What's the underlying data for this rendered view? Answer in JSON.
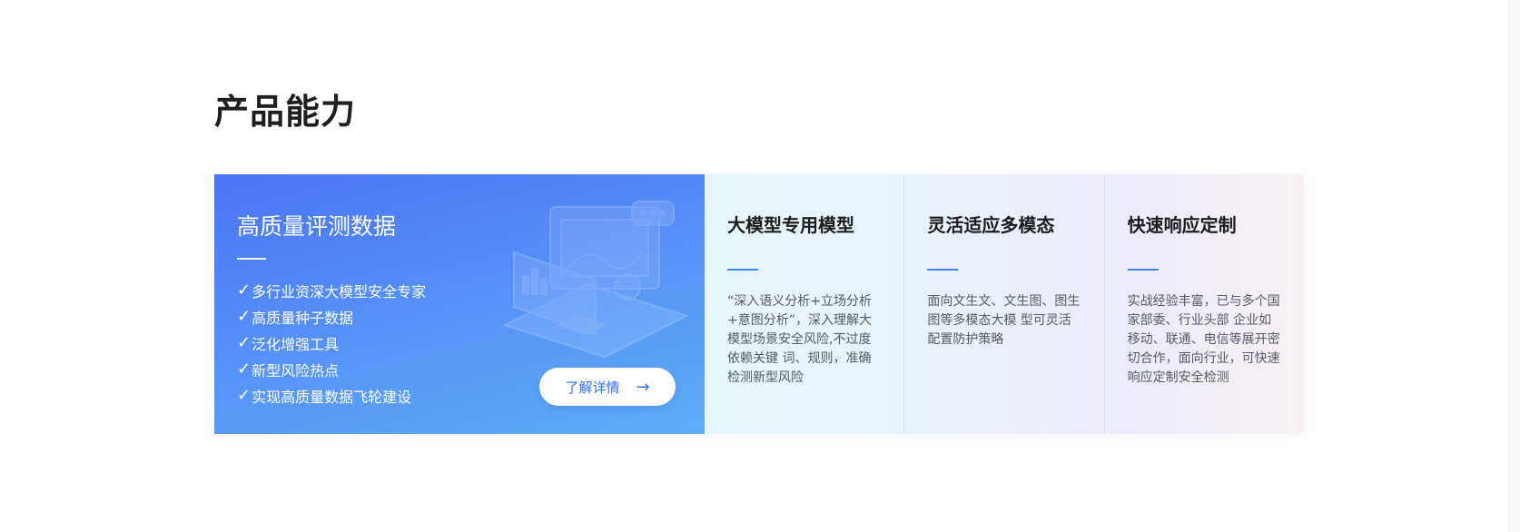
{
  "section": {
    "title": "产品能力"
  },
  "feature_card": {
    "title": "高质量评测数据",
    "check_symbol": "✓",
    "items": [
      "多行业资深大模型安全专家",
      "高质量种子数据",
      "泛化增强工具",
      "新型风险热点",
      "实现高质量数据飞轮建设"
    ],
    "button_label": "了解详情",
    "button_arrow": "→",
    "illustration_icon": "laptop-dashboard-illustration"
  },
  "info_columns": [
    {
      "title": "大模型专用模型",
      "description": "“深入语义分析+立场分析+意图分析”，深入理解大模型场景安全风险,不过度依赖关键 词、规则，准确检测新型风险"
    },
    {
      "title": "灵活适应多模态",
      "description": "面向文生文、文生图、图生图等多模态大模 型可灵活配置防护策略"
    },
    {
      "title": "快速响应定制",
      "description": "实战经验丰富，已与多个国家部委、行业头部 企业如移动、联通、电信等展开密切合作，面向行业，可快速响应定制安全检测"
    }
  ],
  "colors": {
    "feature_gradient_start": "#4b74f6",
    "feature_gradient_end": "#5eaef6",
    "accent_line": "#3d86f5",
    "button_text": "#2f6ff0",
    "title_text": "#1f1f1f"
  }
}
